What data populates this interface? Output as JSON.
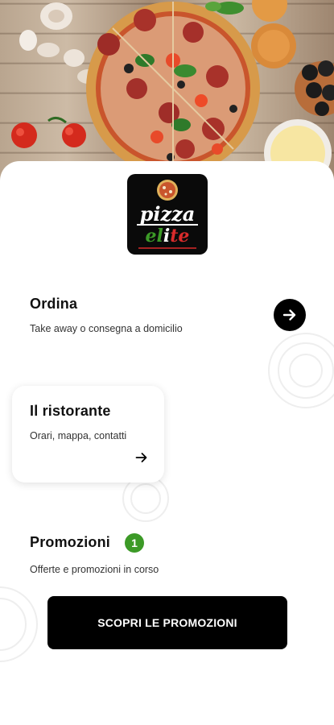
{
  "logo": {
    "line1": "pizza",
    "line2": "elite"
  },
  "order": {
    "title": "Ordina",
    "subtitle": "Take away o consegna a domicilio",
    "arrow_icon": "arrow-right-icon"
  },
  "restaurant": {
    "title": "Il ristorante",
    "subtitle": "Orari, mappa, contatti",
    "arrow_icon": "arrow-right-icon"
  },
  "promotions": {
    "title": "Promozioni",
    "badge_count": "1",
    "subtitle": "Offerte e promozioni in corso",
    "button_label": "SCOPRI LE PROMOZIONI"
  },
  "colors": {
    "accent": "#000000",
    "badge": "#3c9a27",
    "background": "#ffffff"
  }
}
